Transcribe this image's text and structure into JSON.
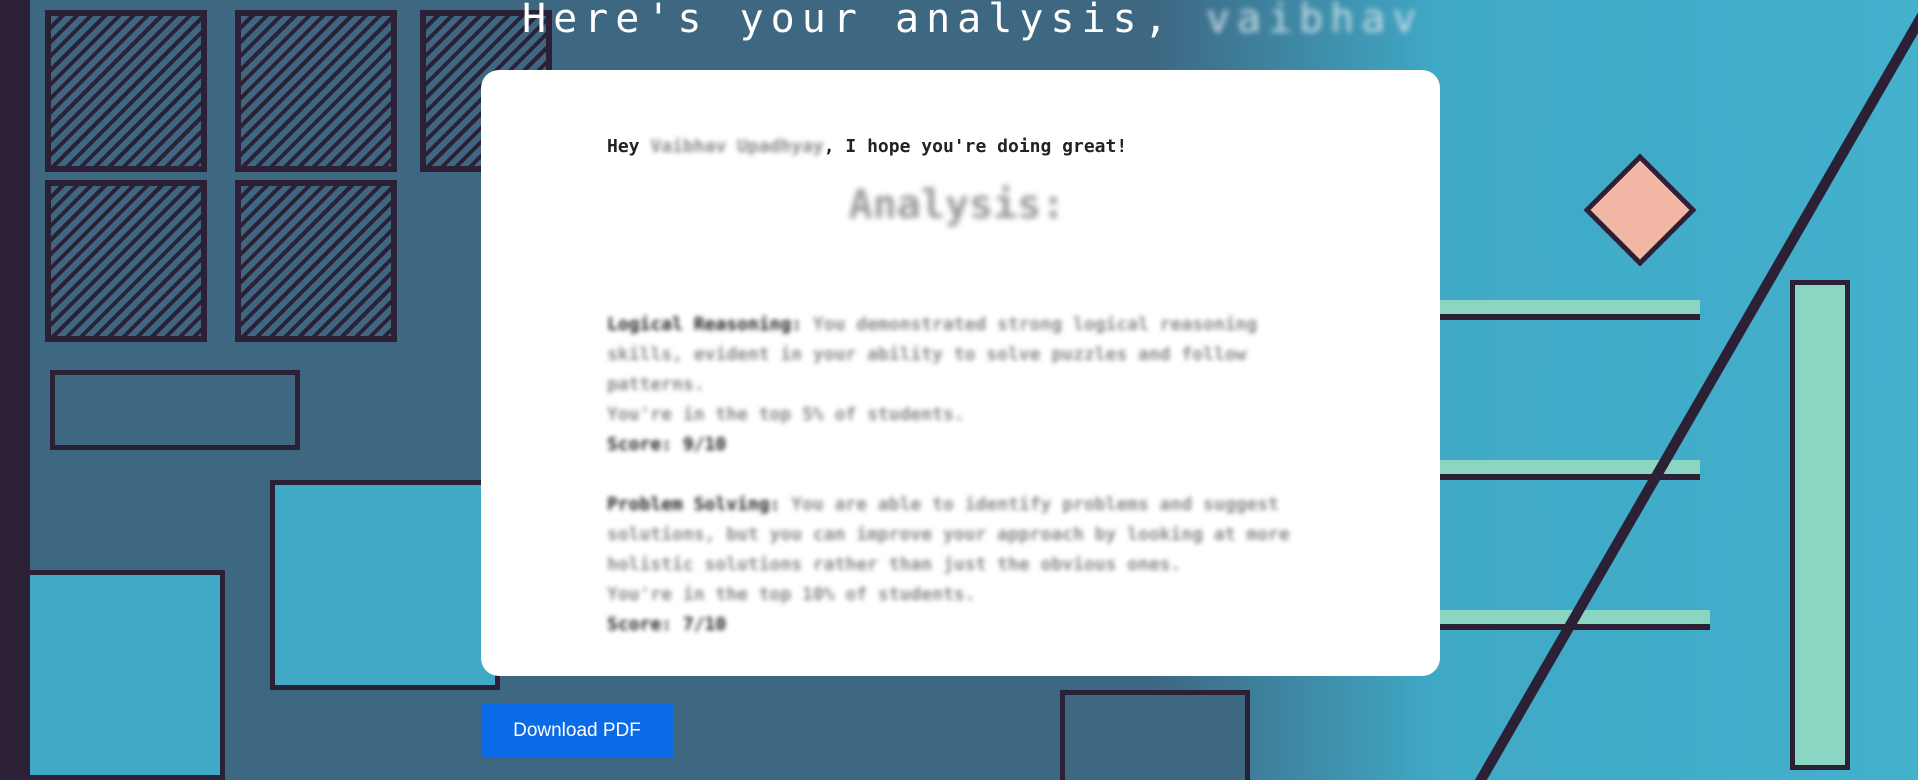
{
  "header": {
    "title_prefix": "Here's your analysis,",
    "user_name": "vaibhav"
  },
  "letter": {
    "greeting_prefix": "Hey",
    "greeting_name": "Vaibhav Upadhyay",
    "greeting_suffix": ", I hope you're doing great!",
    "heading": "Analysis:",
    "sections": [
      {
        "label": "Logical Reasoning:",
        "text": " You demonstrated strong logical reasoning skills, evident in your ability to solve puzzles and follow patterns.",
        "rank": "You're in the top 5% of students.",
        "score": "Score: 9/10"
      },
      {
        "label": "Problem Solving:",
        "text": " You are able to identify problems and suggest solutions, but you can improve your approach by looking at more holistic solutions rather than just the obvious ones.",
        "rank": "You're in the top 10% of students.",
        "score": "Score: 7/10"
      }
    ]
  },
  "actions": {
    "download_label": "Download PDF"
  }
}
